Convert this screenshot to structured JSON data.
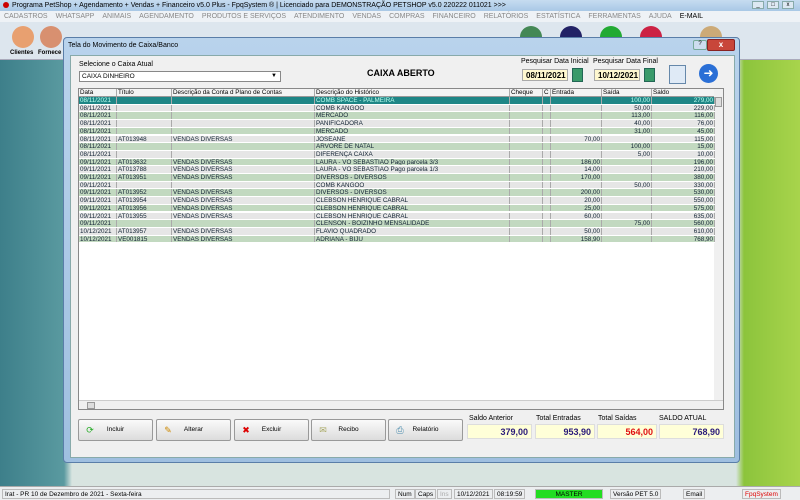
{
  "app": {
    "title": "Programa PetShop + Agendamento + Vendas + Financeiro v5.0 Plus - FpqSystem ® | Licenciado para  DEMONSTRAÇÃO PETSHOP v5.0 220222 011021 >>>"
  },
  "menu": [
    "CADASTROS",
    "WHATSAPP",
    "ANIMAIS",
    "AGENDAMENTO",
    "PRODUTOS E SERVIÇOS",
    "ATENDIMENTO",
    "VENDAS",
    "COMPRAS",
    "FINANCEIRO",
    "RELATÓRIOS",
    "ESTATÍSTICA",
    "FERRAMENTAS",
    "AJUDA",
    "E-MAIL"
  ],
  "toolbar": {
    "clientes": "Clientes",
    "fornece": "Fornece"
  },
  "dialog": {
    "title": "Tela do Movimento de Caixa/Banco",
    "help": "?",
    "close": "x",
    "caixa_label": "Selecione o Caixa Atual",
    "caixa_value": "CAIXA DINHEIRO",
    "status": "CAIXA ABERTO",
    "data_inicial_label": "Pesquisar Data Inicial",
    "data_inicial": "08/11/2021",
    "data_final_label": "Pesquisar Data Final",
    "data_final": "10/12/2021"
  },
  "grid": {
    "columns": [
      "Data",
      "Título",
      "Descrição da Conta d Plano de Contas",
      "Descrição do Histórico",
      "Cheque",
      "C",
      "Entrada",
      "Saída",
      "Saldo"
    ],
    "rows": [
      [
        "08/11/2021",
        "",
        "",
        "COMB SPACE - PALMEIRA",
        "",
        "",
        "",
        "100,00",
        "279,00"
      ],
      [
        "08/11/2021",
        "",
        "",
        "COMB KANGOO",
        "",
        "",
        "",
        "50,00",
        "229,00"
      ],
      [
        "08/11/2021",
        "",
        "",
        "MERCADO",
        "",
        "",
        "",
        "113,00",
        "116,00"
      ],
      [
        "08/11/2021",
        "",
        "",
        "PANIFICADORA",
        "",
        "",
        "",
        "40,00",
        "76,00"
      ],
      [
        "08/11/2021",
        "",
        "",
        "MERCADO",
        "",
        "",
        "",
        "31,00",
        "45,00"
      ],
      [
        "08/11/2021",
        "AT013948",
        "VENDAS DIVERSAS",
        "JOSEANE",
        "",
        "",
        "70,00",
        "",
        "115,00"
      ],
      [
        "08/11/2021",
        "",
        "",
        "ARVORE DE NATAL",
        "",
        "",
        "",
        "100,00",
        "15,00"
      ],
      [
        "08/11/2021",
        "",
        "",
        "DIFERENÇA CAIXA",
        "",
        "",
        "",
        "5,00",
        "10,00"
      ],
      [
        "09/11/2021",
        "AT013632",
        "VENDAS DIVERSAS",
        "LAURA - VÔ SEBASTIÃO Pago parcela 3/3",
        "",
        "",
        "186,00",
        "",
        "196,00"
      ],
      [
        "09/11/2021",
        "AT013788",
        "VENDAS DIVERSAS",
        "LAURA - VÔ SEBASTIÃO Pago parcela 1/3",
        "",
        "",
        "14,00",
        "",
        "210,00"
      ],
      [
        "09/11/2021",
        "AT013951",
        "VENDAS DIVERSAS",
        "DIVERSOS - DIVERSOS",
        "",
        "",
        "170,00",
        "",
        "380,00"
      ],
      [
        "09/11/2021",
        "",
        "",
        "COMB KANGOO",
        "",
        "",
        "",
        "50,00",
        "330,00"
      ],
      [
        "09/11/2021",
        "AT013952",
        "VENDAS DIVERSAS",
        "DIVERSOS - DIVERSOS",
        "",
        "",
        "200,00",
        "",
        "530,00"
      ],
      [
        "09/11/2021",
        "AT013954",
        "VENDAS DIVERSAS",
        "CLEBSON HENRIQUE CABRAL",
        "",
        "",
        "20,00",
        "",
        "550,00"
      ],
      [
        "09/11/2021",
        "AT013956",
        "VENDAS DIVERSAS",
        "CLEBSON HENRIQUE CABRAL",
        "",
        "",
        "25,00",
        "",
        "575,00"
      ],
      [
        "09/11/2021",
        "AT013955",
        "VENDAS DIVERSAS",
        "CLEBSON HENRIQUE CABRAL",
        "",
        "",
        "60,00",
        "",
        "635,00"
      ],
      [
        "09/11/2021",
        "",
        "",
        "CLENSON - BOIZINHO MENSALIDADE",
        "",
        "",
        "",
        "75,00",
        "560,00"
      ],
      [
        "10/12/2021",
        "AT013957",
        "VENDAS DIVERSAS",
        "FLAVIO QUADRADO",
        "",
        "",
        "50,00",
        "",
        "610,00"
      ],
      [
        "10/12/2021",
        "VE001815",
        "VENDAS DIVERSAS",
        "ADRIANA  - BIJU",
        "",
        "",
        "158,90",
        "",
        "768,90"
      ]
    ]
  },
  "buttons": {
    "incluir": "Incluir",
    "alterar": "Alterar",
    "excluir": "Excluir",
    "recibo": "Recibo",
    "relatorio": "Relatório"
  },
  "totals": {
    "saldo_anterior_label": "Saldo Anterior",
    "saldo_anterior": "379,00",
    "entradas_label": "Total Entradas",
    "entradas": "953,90",
    "saidas_label": "Total Saídas",
    "saidas": "564,00",
    "saldo_atual_label": "SALDO ATUAL",
    "saldo_atual": "768,90"
  },
  "colors": {
    "selected_row": "#1e8686",
    "row_green": "#c2d9c0",
    "row_grey": "#e6e6e6",
    "saidas": "#e01010",
    "totals_text": "#2a1a7a",
    "master": "#22dd22"
  },
  "statusbar": {
    "location": "Irat - PR 10 de Dezembro de 2021 - Sexta-feira",
    "num": "Num",
    "caps": "Caps",
    "ins": "Ins",
    "date": "10/12/2021",
    "time": "08:19:59",
    "user": "MASTER",
    "version": "Versão PET 5.0",
    "email": "Email",
    "brand": "FpqSystem"
  }
}
